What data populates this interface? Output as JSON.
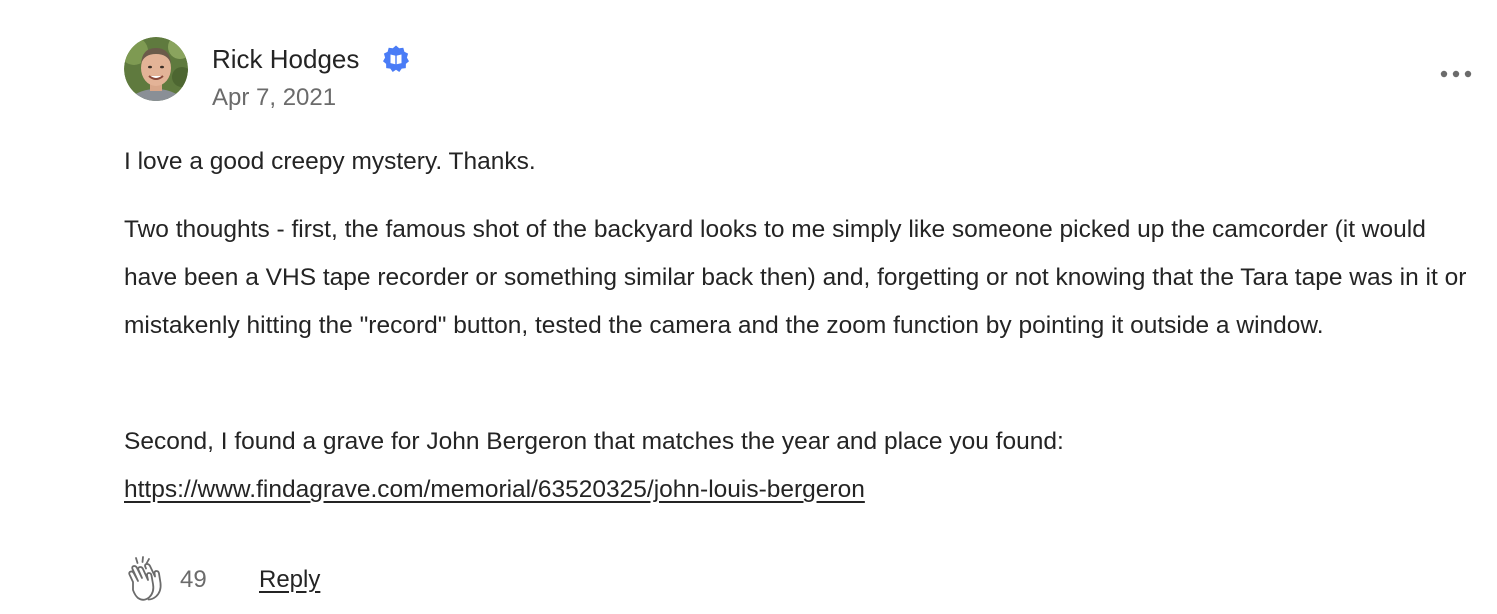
{
  "comment": {
    "author": {
      "name": "Rick Hodges",
      "avatar_icon": "avatar-photo",
      "badge_icon": "verified-book-badge-icon",
      "badge_color": "#4a7cf6"
    },
    "date": "Apr 7, 2021",
    "more_icon": "more-options-icon",
    "body": {
      "p1": "I love a good creepy mystery. Thanks.",
      "p2": "Two thoughts - first, the famous shot of the backyard looks to me simply like someone picked up the camcorder (it would have been a VHS tape recorder or something similar back then) and, forgetting or not knowing that the Tara tape was in it or mistakenly hitting the \"record\" button, tested the camera and the zoom function by pointing it outside a window.",
      "p3_text": "Second, I found a grave for John Bergeron that matches the year and place you found:",
      "p3_link": "https://www.findagrave.com/memorial/63520325/john-louis-bergeron"
    },
    "footer": {
      "clap_icon": "clap-icon",
      "clap_count": "49",
      "reply_label": "Reply"
    }
  }
}
